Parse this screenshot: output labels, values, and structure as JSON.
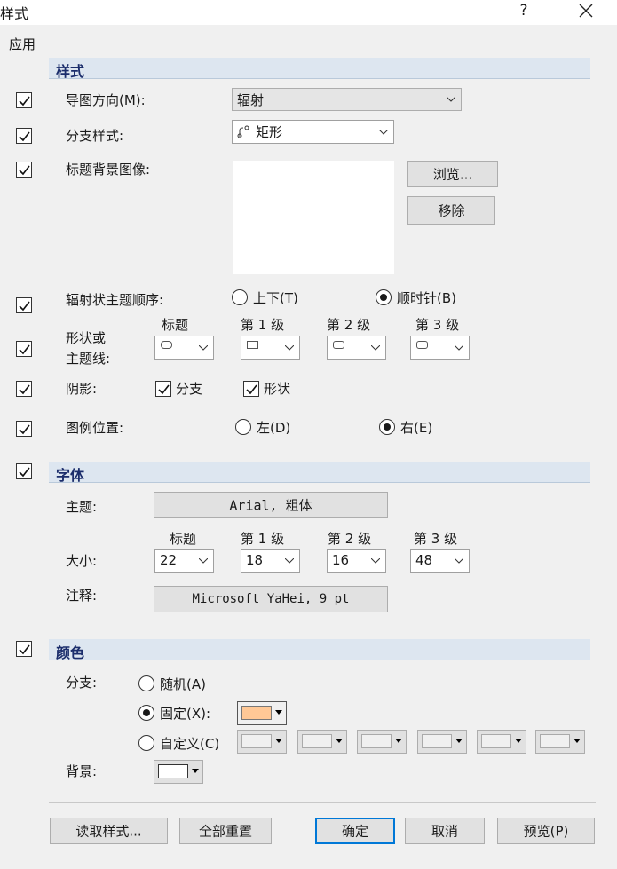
{
  "window": {
    "title": "样式",
    "help": "?"
  },
  "apply_label": "应用",
  "style_section": {
    "title": "样式",
    "direction_label": "导图方向(M):",
    "direction_value": "辐射",
    "branch_style_label": "分支样式:",
    "branch_style_value": "矩形",
    "title_bg_label": "标题背景图像:",
    "browse_label": "浏览...",
    "remove_label": "移除",
    "radial_order_label": "辐射状主题顺序:",
    "order_options": [
      "上下(T)",
      "顺时针(B)"
    ],
    "order_selected": "顺时针(B)",
    "shape_label_line1": "形状或",
    "shape_label_line2": "主题线:",
    "level_headers": [
      "标题",
      "第 1 级",
      "第 2 级",
      "第 3 级"
    ],
    "shadow_label": "阴影:",
    "shadow_options": [
      "分支",
      "形状"
    ],
    "legend_pos_label": "图例位置:",
    "legend_options": [
      "左(D)",
      "右(E)"
    ],
    "legend_selected": "右(E)"
  },
  "font_section": {
    "title": "字体",
    "topic_label": "主题:",
    "topic_font": "Arial, 粗体",
    "level_headers": [
      "标题",
      "第 1 级",
      "第 2 级",
      "第 3 级"
    ],
    "size_label": "大小:",
    "sizes": [
      "22",
      "18",
      "16",
      "48"
    ],
    "note_label": "注释:",
    "note_font": "Microsoft YaHei, 9 pt"
  },
  "color_section": {
    "title": "颜色",
    "branch_label": "分支:",
    "random_label": "随机(A)",
    "fixed_label": "固定(X):",
    "custom_label": "自定义(C)",
    "branch_selected": "固定(X)",
    "fixed_color": "#ffc896",
    "background_label": "背景:",
    "background_color": "#ffffff"
  },
  "footer": {
    "read_style": "读取样式...",
    "reset_all": "全部重置",
    "ok": "确定",
    "cancel": "取消",
    "preview": "预览(P)"
  },
  "colors": {
    "accent": "#0078d7",
    "section_bg": "#dde6f0",
    "section_text": "#1b2d6b"
  }
}
